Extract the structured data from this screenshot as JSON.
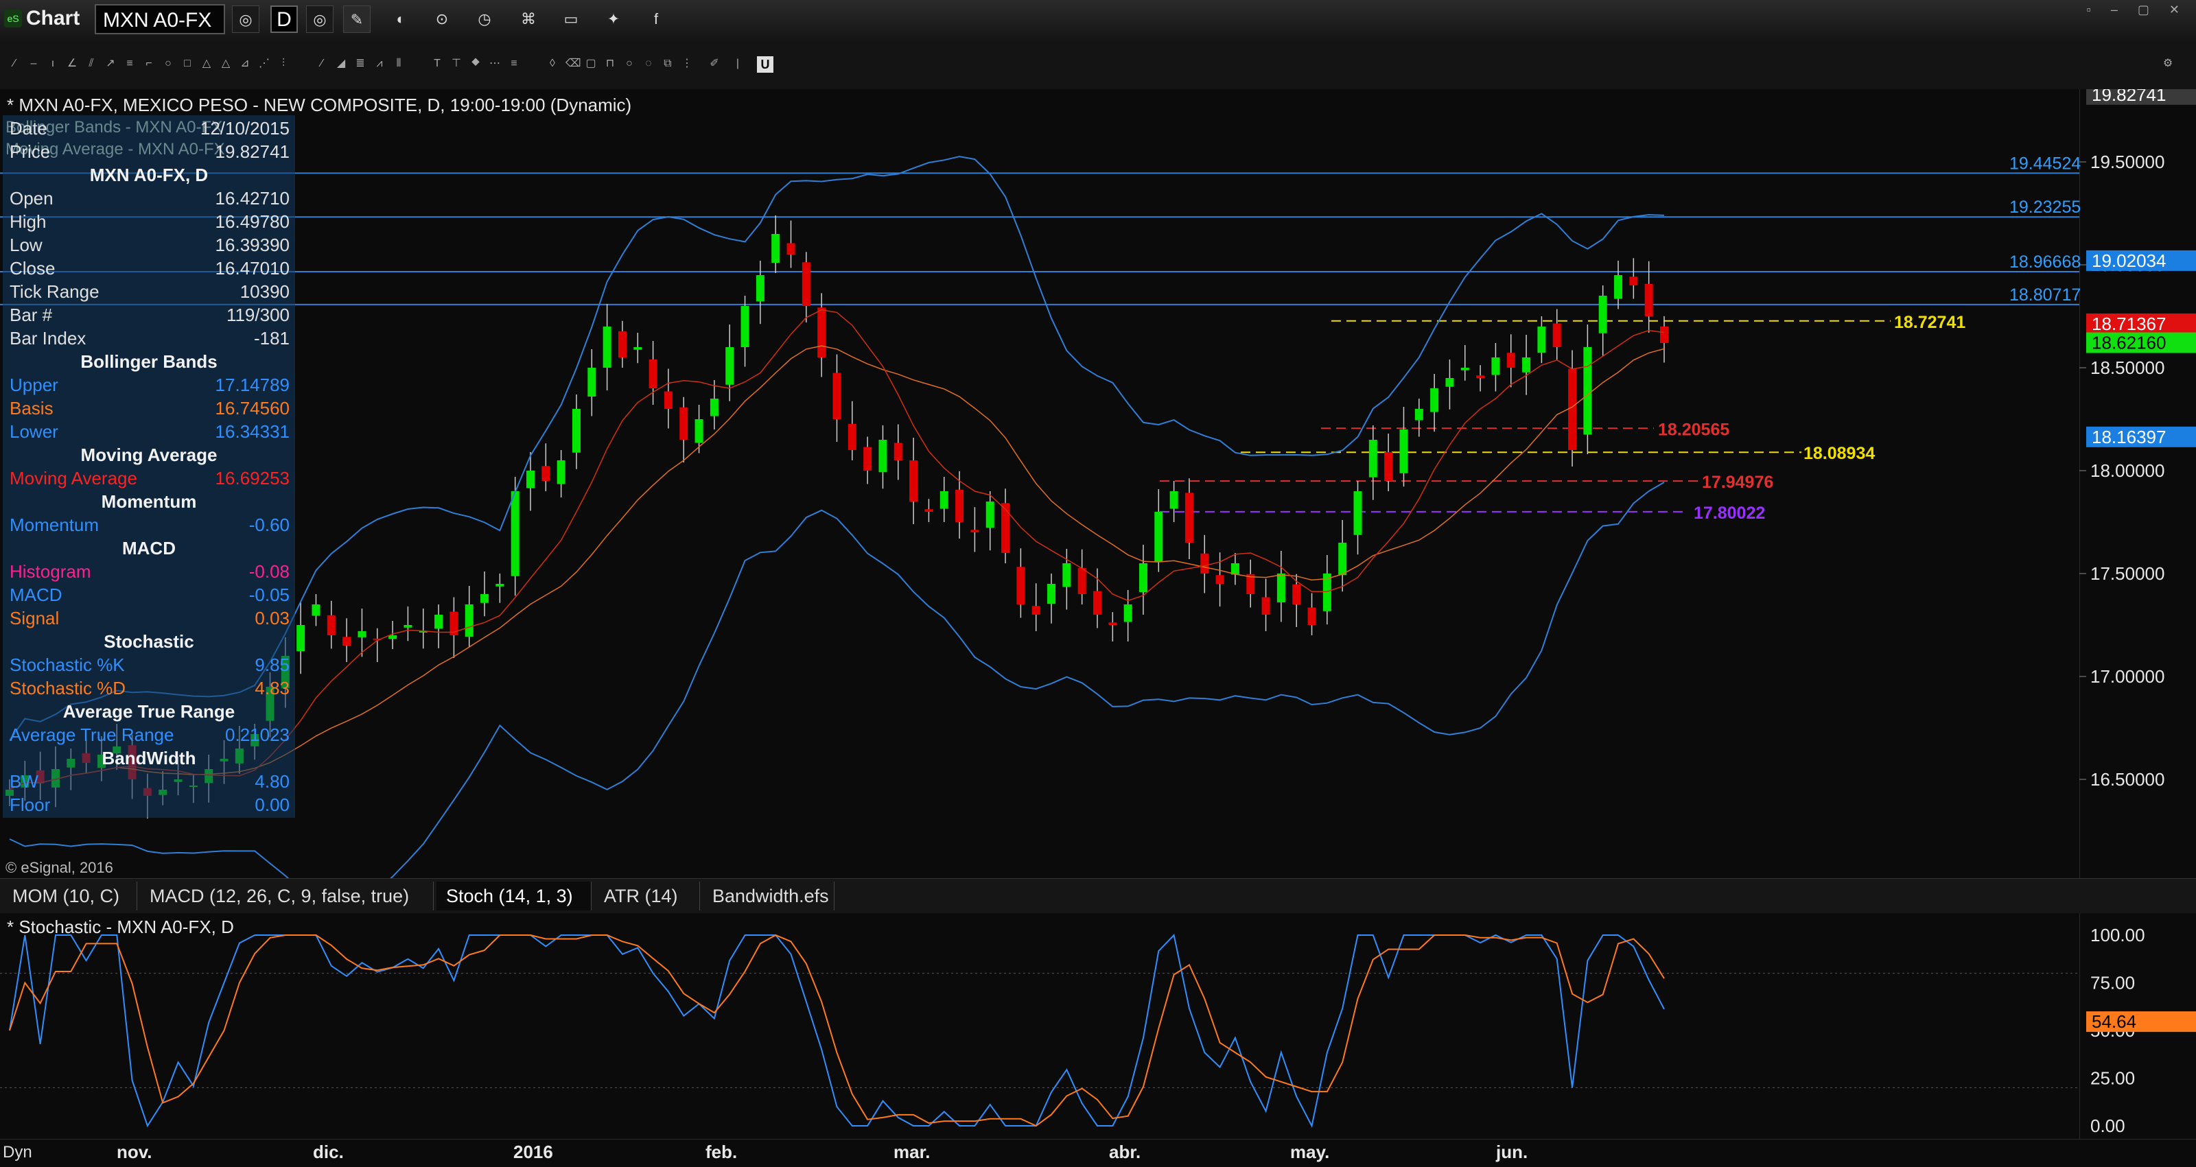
{
  "window": {
    "title": "Chart",
    "symbol": "MXN A0-FX",
    "interval": "D",
    "logo": "eS"
  },
  "chart_header": "* MXN A0-FX, MEXICO PESO - NEW COMPOSITE, D, 19:00-19:00 (Dynamic)",
  "ghost_labels": [
    "Bollinger Bands - MXN A0-FX",
    "Moving Average - MXN A0-FX"
  ],
  "data_window": {
    "date": {
      "label": "Date",
      "value": "12/10/2015"
    },
    "price": {
      "label": "Price",
      "value": "19.82741"
    },
    "section_symbol": "MXN A0-FX, D",
    "open": {
      "label": "Open",
      "value": "16.42710"
    },
    "high": {
      "label": "High",
      "value": "16.49780"
    },
    "low": {
      "label": "Low",
      "value": "16.39390"
    },
    "close": {
      "label": "Close",
      "value": "16.47010"
    },
    "tick_range": {
      "label": "Tick Range",
      "value": "10390"
    },
    "bar_num": {
      "label": "Bar #",
      "value": "119/300"
    },
    "bar_index": {
      "label": "Bar Index",
      "value": "-181"
    },
    "section_bb": "Bollinger Bands",
    "upper": {
      "label": "Upper",
      "value": "17.14789"
    },
    "basis": {
      "label": "Basis",
      "value": "16.74560"
    },
    "lower": {
      "label": "Lower",
      "value": "16.34331"
    },
    "section_ma": "Moving Average",
    "ma": {
      "label": "Moving Average",
      "value": "16.69253"
    },
    "section_mom": "Momentum",
    "momentum": {
      "label": "Momentum",
      "value": "-0.60"
    },
    "section_macd": "MACD",
    "histogram": {
      "label": "Histogram",
      "value": "-0.08"
    },
    "macd": {
      "label": "MACD",
      "value": "-0.05"
    },
    "signal": {
      "label": "Signal",
      "value": "0.03"
    },
    "section_stoch": "Stochastic",
    "stoch_k": {
      "label": "Stochastic %K",
      "value": "9.85"
    },
    "stoch_d": {
      "label": "Stochastic %D",
      "value": "4.83"
    },
    "section_atr": "Average True Range",
    "atr": {
      "label": "Average True Range",
      "value": "0.21023"
    },
    "section_bw": "BandWidth",
    "bw": {
      "label": "BW",
      "value": "4.80"
    },
    "floor": {
      "label": "Floor",
      "value": "0.00"
    }
  },
  "price_axis": {
    "ticks": [
      "19.50000",
      "19.00000",
      "18.50000",
      "18.00000",
      "17.50000",
      "17.00000",
      "16.50000"
    ],
    "tags": {
      "top": "19.82741",
      "blue": "19.02034",
      "red": "18.71367",
      "green": "18.62160",
      "lower_blue": "18.16397"
    }
  },
  "levels": {
    "h1": "19.44524",
    "h2": "19.23255",
    "h3": "18.96668",
    "h4": "18.80717",
    "y1": "18.72741",
    "r1": "18.20565",
    "y2": "18.08934",
    "r2": "17.94976",
    "p1": "17.80022"
  },
  "copyright": "© eSignal, 2016",
  "tabs": [
    "MOM (10, C)",
    "MACD (12, 26, C, 9, false, true)",
    "Stoch (14, 1, 3)",
    "ATR (14)",
    "Bandwidth.efs"
  ],
  "stoch": {
    "title": "* Stochastic - MXN A0-FX, D",
    "ticks": [
      "100.00",
      "75.00",
      "50.00",
      "25.00",
      "0.00"
    ],
    "tag": "54.64"
  },
  "x_axis": {
    "dyn": "Dyn",
    "months": [
      "nov.",
      "dic.",
      "2016",
      "feb.",
      "mar.",
      "abr.",
      "may.",
      "jun."
    ]
  },
  "colors": {
    "up": "#00e600",
    "down": "#e00000",
    "bb": "#2f7fd6",
    "ma": "#d03010",
    "ma2": "#e07020",
    "yellow": "#f0e000",
    "purple": "#9a30ff"
  },
  "chart_data": {
    "type": "candlestick",
    "price_range": [
      16.2,
      19.85
    ],
    "note_dates": [
      "nov.",
      "dic.",
      "2016",
      "feb.",
      "mar.",
      "abr.",
      "may.",
      "jun."
    ],
    "close_path": [
      16.45,
      16.52,
      16.48,
      16.55,
      16.6,
      16.58,
      16.62,
      16.66,
      16.5,
      16.42,
      16.45,
      16.5,
      16.47,
      16.55,
      16.6,
      16.65,
      16.72,
      16.95,
      17.1,
      17.25,
      17.35,
      17.2,
      17.15,
      17.22,
      17.18,
      17.2,
      17.25,
      17.22,
      17.3,
      17.2,
      17.35,
      17.4,
      17.45,
      17.9,
      18.0,
      17.95,
      18.05,
      18.3,
      18.5,
      18.7,
      18.55,
      18.6,
      18.4,
      18.3,
      18.15,
      18.25,
      18.35,
      18.6,
      18.8,
      18.95,
      19.15,
      19.05,
      18.8,
      18.55,
      18.25,
      18.1,
      18.0,
      18.15,
      18.05,
      17.85,
      17.8,
      17.9,
      17.75,
      17.7,
      17.85,
      17.6,
      17.35,
      17.3,
      17.45,
      17.55,
      17.4,
      17.3,
      17.25,
      17.35,
      17.55,
      17.8,
      17.9,
      17.65,
      17.5,
      17.45,
      17.55,
      17.4,
      17.3,
      17.5,
      17.35,
      17.25,
      17.5,
      17.65,
      17.9,
      18.15,
      17.95,
      18.2,
      18.3,
      18.4,
      18.45,
      18.5,
      18.45,
      18.55,
      18.5,
      18.55,
      18.7,
      18.6,
      18.1,
      18.6,
      18.85,
      18.95,
      18.9,
      18.75,
      18.62
    ]
  }
}
